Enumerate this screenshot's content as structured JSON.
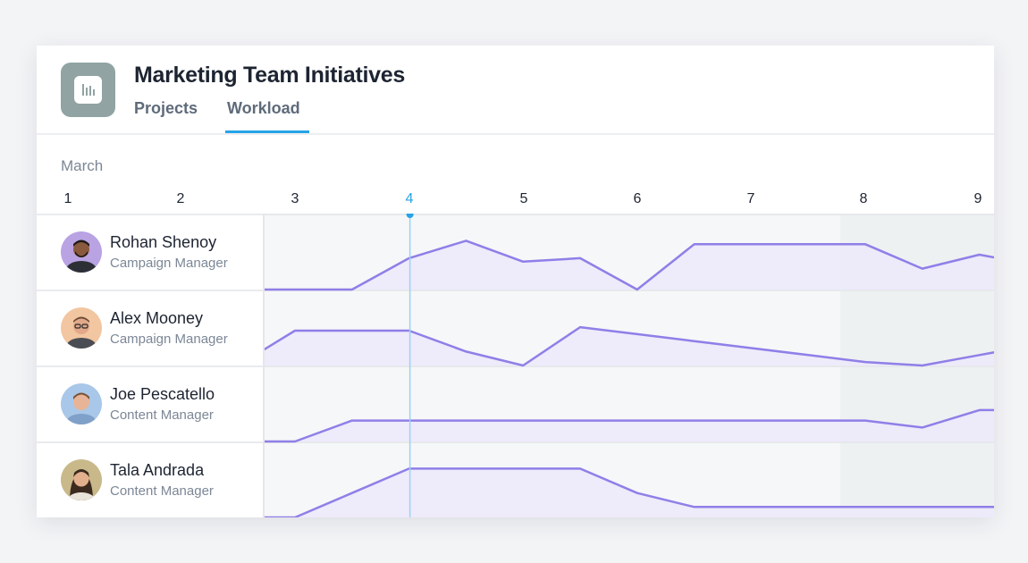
{
  "header": {
    "title": "Marketing Team Initiatives",
    "tabs": [
      {
        "label": "Projects",
        "active": false
      },
      {
        "label": "Workload",
        "active": true
      }
    ],
    "icon": "bar-chart-icon"
  },
  "calendar": {
    "month": "March",
    "days": [
      "1",
      "2",
      "3",
      "4",
      "5",
      "6",
      "7",
      "8",
      "9"
    ],
    "today": "4"
  },
  "people": [
    {
      "name": "Rohan Shenoy",
      "role": "Campaign Manager",
      "avatar_bg": "#b9a3e3"
    },
    {
      "name": "Alex Mooney",
      "role": "Campaign Manager",
      "avatar_bg": "#f2c6a0"
    },
    {
      "name": "Joe Pescatello",
      "role": "Content Manager",
      "avatar_bg": "#a9c7e8"
    },
    {
      "name": "Tala Andrada",
      "role": "Content Manager",
      "avatar_bg": "#c9b98a"
    }
  ],
  "colors": {
    "accent": "#27a3e6",
    "workload_line": "#8f7fe8",
    "workload_fill": "#ece9fb",
    "weekend_shade": "#eef1f2"
  },
  "chart_data": {
    "type": "area",
    "x": [
      2.5,
      3,
      3.5,
      4,
      4.5,
      5,
      5.5,
      6,
      6.5,
      7,
      7.5,
      8,
      8.5,
      9,
      9.5
    ],
    "series": [
      {
        "values": [
          0,
          0,
          0,
          0.45,
          0.7,
          0.4,
          0.45,
          0.0,
          0.65,
          0.65,
          0.65,
          0.65,
          0.3,
          0.5,
          0.35
        ]
      },
      {
        "values": [
          0,
          0.5,
          0.5,
          0.5,
          0.2,
          0,
          0.55,
          0.45,
          0.35,
          0.25,
          0.15,
          0.05,
          0,
          0.15,
          0.3
        ]
      },
      {
        "values": [
          0,
          0,
          0.3,
          0.3,
          0.3,
          0.3,
          0.3,
          0.3,
          0.3,
          0.3,
          0.3,
          0.3,
          0.2,
          0.45,
          0.45
        ]
      },
      {
        "values": [
          0,
          0,
          0.35,
          0.7,
          0.7,
          0.7,
          0.7,
          0.35,
          0.15,
          0.15,
          0.15,
          0.15,
          0.15,
          0.15,
          0.15
        ]
      }
    ]
  }
}
